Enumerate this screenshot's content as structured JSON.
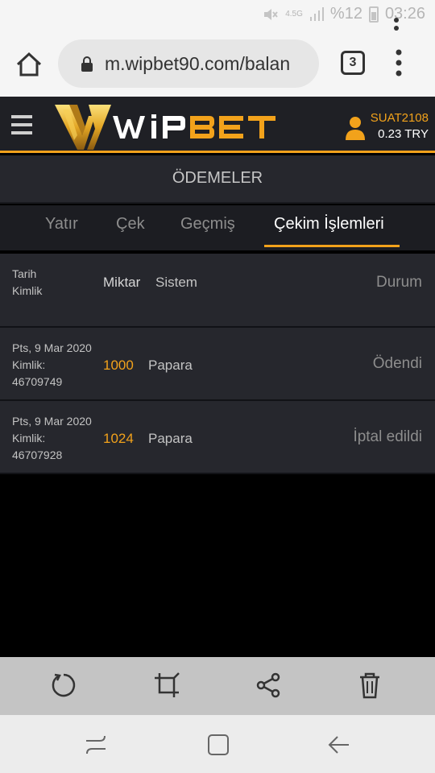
{
  "status_bar": {
    "network": "4.5G",
    "battery": "%12",
    "time": "03:26"
  },
  "browser": {
    "url": "m.wipbet90.com/balan",
    "tab_count": "3"
  },
  "header": {
    "logo_text": "WiPBET",
    "username": "SUAT2108",
    "balance": "0.23 TRY"
  },
  "page_title": "ÖDEMELER",
  "tabs": [
    {
      "label": "Yatır",
      "active": false
    },
    {
      "label": "Çek",
      "active": false
    },
    {
      "label": "Geçmiş",
      "active": false
    },
    {
      "label": "Çekim İşlemleri",
      "active": true
    }
  ],
  "table": {
    "columns": {
      "date_line1": "Tarih",
      "date_line2": "Kimlik",
      "amount": "Miktar",
      "system": "Sistem",
      "status": "Durum"
    },
    "rows": [
      {
        "date": "Pts, 9 Mar 2020",
        "id_label": "Kimlik:",
        "id": "46709749",
        "amount": "1000",
        "system": "Papara",
        "status": "Ödendi"
      },
      {
        "date": "Pts, 9 Mar 2020",
        "id_label": "Kimlik:",
        "id": "46707928",
        "amount": "1024",
        "system": "Papara",
        "status": "İptal edildi"
      }
    ]
  },
  "colors": {
    "accent": "#f2a21b",
    "header_bg": "#1f2025",
    "row_bg": "#26272d"
  },
  "icons": {
    "toolbar": [
      "rotate-icon",
      "crop-icon",
      "share-icon",
      "delete-icon"
    ],
    "nav": [
      "recent-apps-icon",
      "home-icon",
      "back-icon"
    ]
  }
}
